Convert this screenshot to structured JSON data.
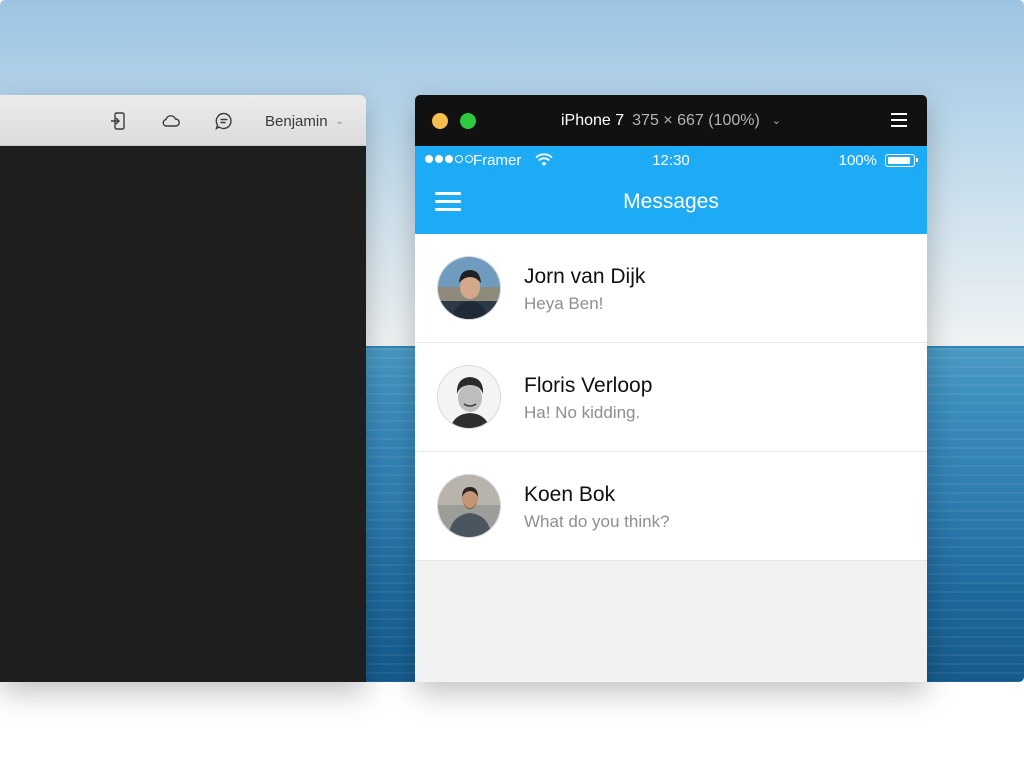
{
  "editor": {
    "toolbar": {
      "icons": [
        "device-export-icon",
        "cloud-icon",
        "chat-bubble-icon"
      ],
      "user_name": "Benjamin",
      "user_chevron": "⌄"
    }
  },
  "device": {
    "model": "iPhone 7",
    "dimensions": "375 × 667 (100%)",
    "chevron": "⌄",
    "traffic_lights": [
      "#f5bf4f",
      "#2ec940"
    ]
  },
  "status_bar": {
    "carrier": "Framer",
    "time": "12:30",
    "battery": "100%",
    "signal_bars": 5,
    "signal_filled": 3
  },
  "nav": {
    "title": "Messages"
  },
  "messages": [
    {
      "name": "Jorn van Dijk",
      "preview": "Heya Ben!"
    },
    {
      "name": "Floris Verloop",
      "preview": "Ha! No kidding."
    },
    {
      "name": "Koen Bok",
      "preview": "What do you think?"
    }
  ],
  "colors": {
    "accent": "#1eabf5",
    "editor_bg": "#1e1e1e",
    "titlebar_bg": "#111111",
    "list_bg": "#f2f2f2"
  }
}
